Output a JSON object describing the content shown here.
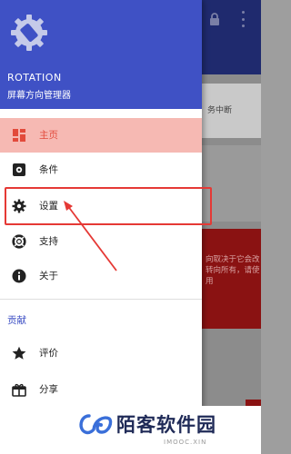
{
  "drawer": {
    "app_name": "ROTATION",
    "app_subtitle": "屏幕方向管理器",
    "menu": [
      {
        "label": "主页",
        "icon": "dashboard-icon",
        "active": true
      },
      {
        "label": "条件",
        "icon": "conditions-icon",
        "active": false
      },
      {
        "label": "设置",
        "icon": "gear-icon",
        "active": false
      },
      {
        "label": "支持",
        "icon": "lifebuoy-icon",
        "active": false
      },
      {
        "label": "关于",
        "icon": "info-icon",
        "active": false
      }
    ],
    "section_title": "贡献",
    "contribute": [
      {
        "label": "评价",
        "icon": "star-icon"
      },
      {
        "label": "分享",
        "icon": "gift-icon"
      }
    ]
  },
  "background": {
    "card_text": "务中断",
    "notice_text": "向取决于它会改转向所有，请使用"
  },
  "watermark": {
    "title": "陌客软件园",
    "subtitle": "IMOOC.XIN"
  },
  "colors": {
    "header": "#3f51c5",
    "active_bg": "#f6b9b3",
    "active_text": "#e24a3b",
    "highlight": "#e53935"
  }
}
